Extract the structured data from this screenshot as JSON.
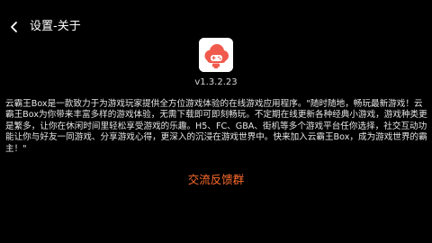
{
  "header": {
    "back_icon": "chevron-left-icon",
    "title": "设置-关于"
  },
  "app": {
    "logo_icon": "cloud-gamepad-logo-icon",
    "logo_color": "#f05a4c",
    "version": "v1.3.2.23"
  },
  "about": {
    "description": "云霸王Box是一款致力于为游戏玩家提供全方位游戏体验的在线游戏应用程序。\"随时随地，畅玩最新游戏！云霸王Box为你带来丰富多样的游戏体验，无需下载即可即刻畅玩。不定期在线更新各种经典小游戏，游戏种类更是繁多，让你在休闲时间里轻松享受游戏的乐趣。H5、FC、GBA、街机等多个游戏平台任你选择，社交互动功能让你与好友一同游戏、分享游戏心得，更深入的沉浸在游戏世界中。快来加入云霸王Box，成为游戏世界的霸主！\"",
    "group_link": "交流反馈群",
    "link_color": "#ff6c2c"
  }
}
